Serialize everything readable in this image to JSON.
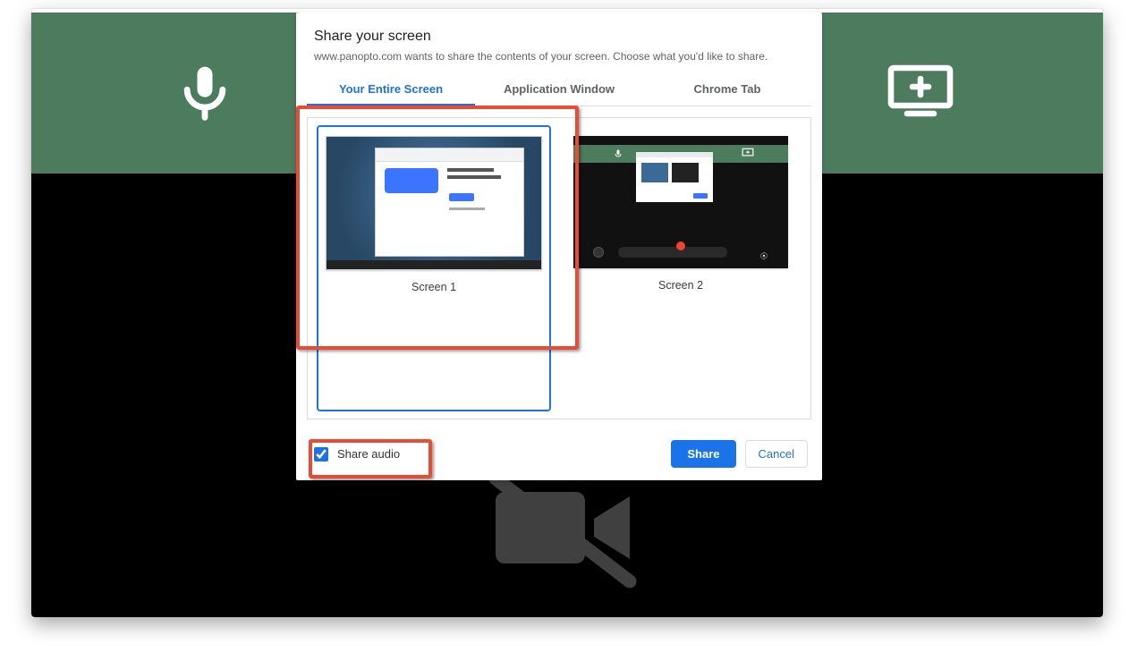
{
  "header": {
    "mic_icon": "microphone-icon",
    "add_screen_icon": "add-screen-icon"
  },
  "dialog": {
    "title": "Share your screen",
    "subtitle": "www.panopto.com wants to share the contents of your screen. Choose what you'd like to share.",
    "tabs": [
      {
        "label": "Your Entire Screen",
        "active": true
      },
      {
        "label": "Application Window",
        "active": false
      },
      {
        "label": "Chrome Tab",
        "active": false
      }
    ],
    "screens": [
      {
        "label": "Screen 1",
        "selected": true
      },
      {
        "label": "Screen 2",
        "selected": false
      }
    ],
    "share_audio_label": "Share audio",
    "share_audio_checked": true,
    "share_btn": "Share",
    "cancel_btn": "Cancel"
  }
}
